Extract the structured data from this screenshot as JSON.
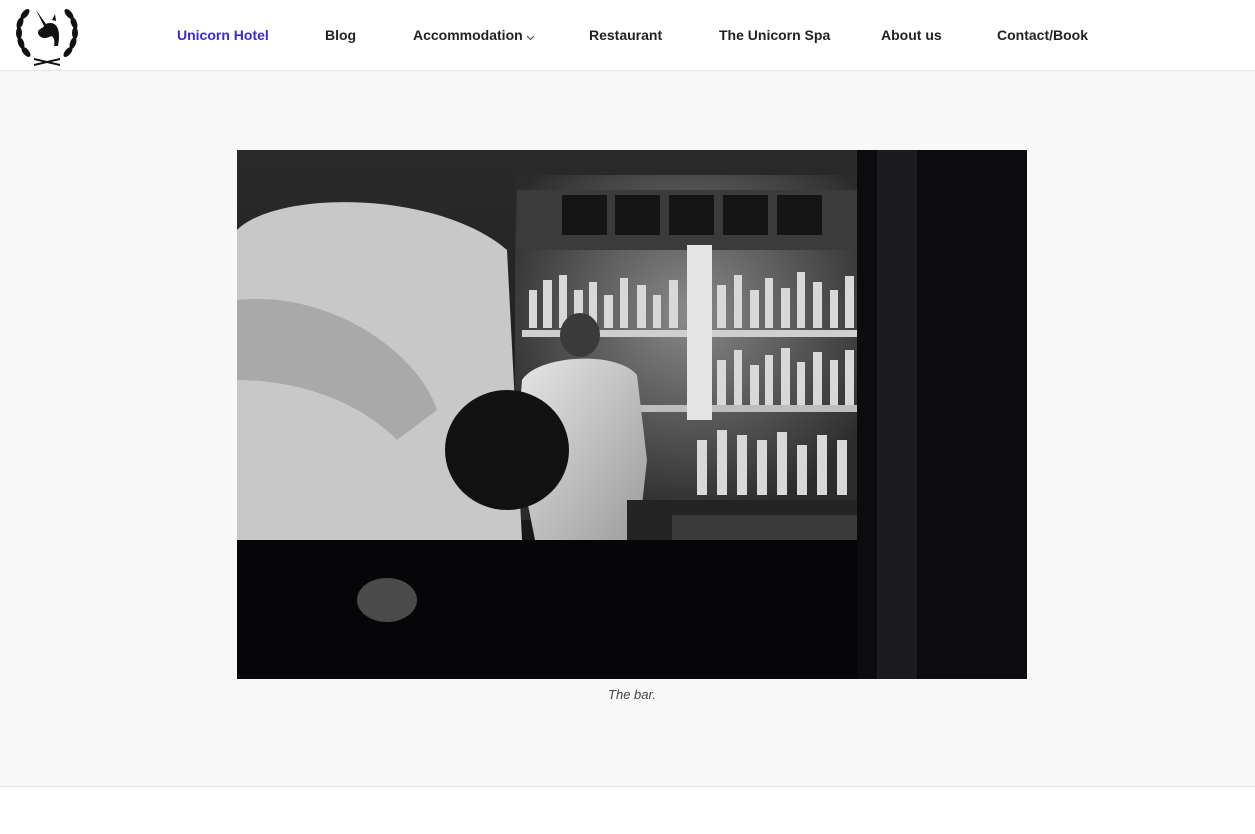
{
  "nav": {
    "items": [
      {
        "label": "Unicorn Hotel",
        "active": true
      },
      {
        "label": "Blog",
        "active": false
      },
      {
        "label": "Accommodation",
        "active": false,
        "dropdown": true
      },
      {
        "label": "Restaurant",
        "active": false
      },
      {
        "label": "The Unicorn Spa",
        "active": false
      },
      {
        "label": "About us",
        "active": false
      },
      {
        "label": "Contact/Book",
        "active": false
      }
    ]
  },
  "logo": {
    "icon": "unicorn-laurel-icon"
  },
  "figure": {
    "image_subject": "bar-interior-photo",
    "caption": "The bar."
  },
  "colors": {
    "nav_active": "#3a2bd1",
    "nav_text": "#222222",
    "page_background": "#f8f8f8"
  }
}
